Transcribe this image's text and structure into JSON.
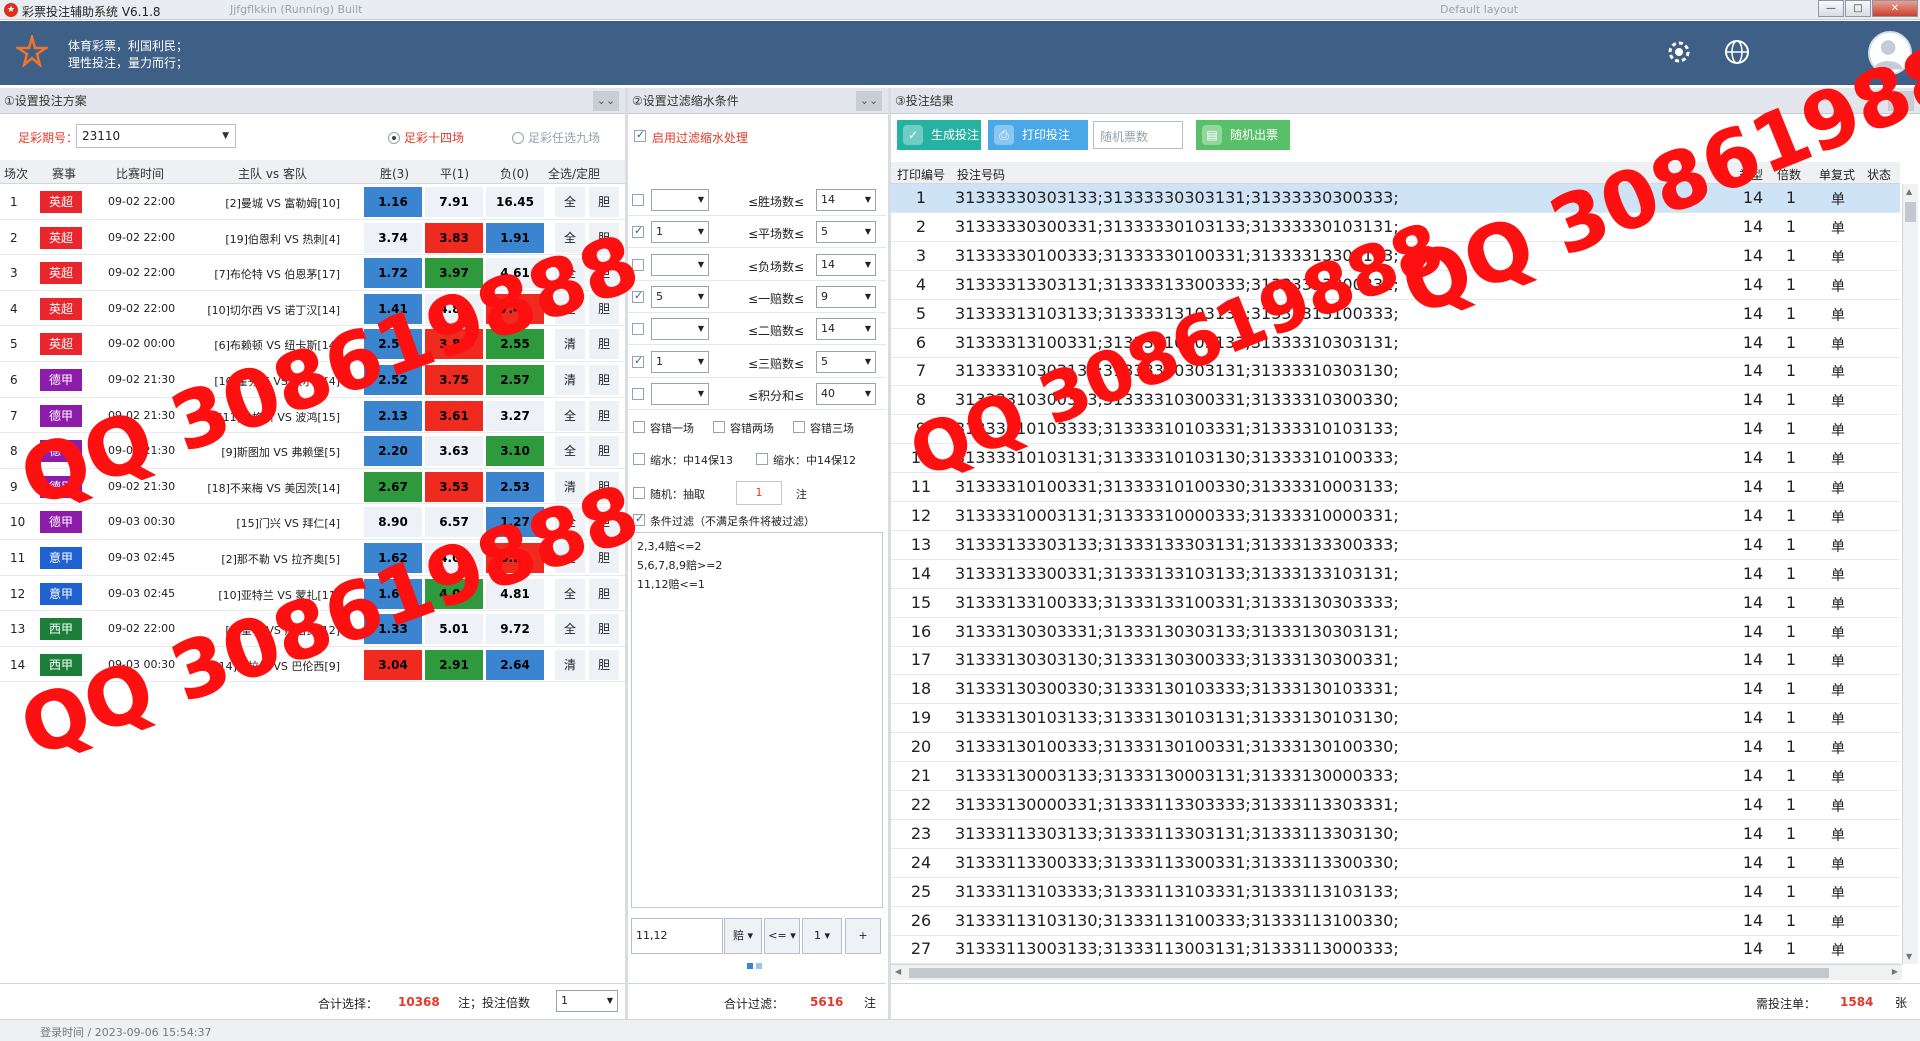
{
  "window": {
    "title": "彩票投注辅助系统 V6.1.8",
    "ghost_text": "Jjfgflkkin (Running) Built",
    "ghost_right": "Default layout"
  },
  "header": {
    "slogan1": "体育彩票，利国利民；",
    "slogan2": "理性投注，量力而行；"
  },
  "panel1": {
    "title": "①设置投注方案",
    "issue_label": "足彩期号：",
    "issue_value": "23110",
    "radio1": "足彩十四场",
    "radio2": "足彩任选九场",
    "columns": [
      "场次",
      "赛事",
      "比赛时间",
      "主队 vs 客队",
      "胜(3)",
      "平(1)",
      "负(0)",
      "全选/定胆"
    ],
    "rows": [
      {
        "idx": "1",
        "league": "英超",
        "lc": "#e8262b",
        "time": "09-02 22:00",
        "teams": "[2]曼城 VS 富勒姆[10]",
        "w": "1.16",
        "d": "7.91",
        "l": "16.45",
        "wc": "blue",
        "dc": "white",
        "lcx": "white",
        "b1": "全",
        "b2": "胆"
      },
      {
        "idx": "2",
        "league": "英超",
        "lc": "#e8262b",
        "time": "09-02 22:00",
        "teams": "[19]伯恩利 VS 热刺[4]",
        "w": "3.74",
        "d": "3.83",
        "l": "1.91",
        "wc": "white",
        "dc": "red",
        "lcx": "blue",
        "b1": "全",
        "b2": "胆"
      },
      {
        "idx": "3",
        "league": "英超",
        "lc": "#e8262b",
        "time": "09-02 22:00",
        "teams": "[7]布伦特 VS 伯恩茅[17]",
        "w": "1.72",
        "d": "3.97",
        "l": "4.61",
        "wc": "blue",
        "dc": "green",
        "lcx": "white",
        "b1": "全",
        "b2": "胆"
      },
      {
        "idx": "4",
        "league": "英超",
        "lc": "#e8262b",
        "time": "09-02 22:00",
        "teams": "[10]切尔西 VS 诺丁汉[14]",
        "w": "1.41",
        "d": "4.82",
        "l": "7.48",
        "wc": "blue",
        "dc": "white",
        "lcx": "red",
        "b1": "全",
        "b2": "胆"
      },
      {
        "idx": "5",
        "league": "英超",
        "lc": "#e8262b",
        "time": "09-02 00:00",
        "teams": "[6]布赖顿 VS 纽卡斯[14]",
        "w": "2.52",
        "d": "3.82",
        "l": "2.55",
        "wc": "blue",
        "dc": "red",
        "lcx": "green",
        "b1": "清",
        "b2": "胆"
      },
      {
        "idx": "6",
        "league": "德甲",
        "lc": "#8e1cab",
        "time": "09-02 21:30",
        "teams": "[10]霍芬海 VS 沃尔夫[4]",
        "w": "2.52",
        "d": "3.75",
        "l": "2.57",
        "wc": "blue",
        "dc": "red",
        "lcx": "green",
        "b1": "清",
        "b2": "胆"
      },
      {
        "idx": "7",
        "league": "德甲",
        "lc": "#8e1cab",
        "time": "09-02 21:30",
        "teams": "[11]奥格斯 VS 波鸿[15]",
        "w": "2.13",
        "d": "3.61",
        "l": "3.27",
        "wc": "blue",
        "dc": "red",
        "lcx": "white",
        "b1": "全",
        "b2": "胆"
      },
      {
        "idx": "8",
        "league": "德甲",
        "lc": "#8e1cab",
        "time": "09-02 21:30",
        "teams": "[9]斯图加 VS 弗赖堡[5]",
        "w": "2.20",
        "d": "3.63",
        "l": "3.10",
        "wc": "blue",
        "dc": "white",
        "lcx": "green",
        "b1": "全",
        "b2": "胆"
      },
      {
        "idx": "9",
        "league": "德甲",
        "lc": "#8e1cab",
        "time": "09-02 21:30",
        "teams": "[18]不来梅 VS 美因茨[14]",
        "w": "2.67",
        "d": "3.53",
        "l": "2.53",
        "wc": "green",
        "dc": "red",
        "lcx": "blue",
        "b1": "清",
        "b2": "胆"
      },
      {
        "idx": "10",
        "league": "德甲",
        "lc": "#8e1cab",
        "time": "09-03 00:30",
        "teams": "[15]门兴 VS 拜仁[4]",
        "w": "8.90",
        "d": "6.57",
        "l": "1.27",
        "wc": "white",
        "dc": "white",
        "lcx": "blue",
        "b1": "全",
        "b2": "胆"
      },
      {
        "idx": "11",
        "league": "意甲",
        "lc": "#1f62cf",
        "time": "09-03 02:45",
        "teams": "[2]那不勒 VS 拉齐奥[5]",
        "w": "1.62",
        "d": "4.08",
        "l": "5.22",
        "wc": "blue",
        "dc": "white",
        "lcx": "red",
        "b1": "全",
        "b2": "胆"
      },
      {
        "idx": "12",
        "league": "意甲",
        "lc": "#1f62cf",
        "time": "09-03 02:45",
        "teams": "[10]亚特兰 VS 蒙扎[11]",
        "w": "1.67",
        "d": "4.06",
        "l": "4.81",
        "wc": "blue",
        "dc": "green",
        "lcx": "white",
        "b1": "全",
        "b2": "胆"
      },
      {
        "idx": "13",
        "league": "西甲",
        "lc": "#1b7f3a",
        "time": "09-02 22:00",
        "teams": "[1]皇马 VS 赫塔费[12]",
        "w": "1.33",
        "d": "5.01",
        "l": "9.72",
        "wc": "blue",
        "dc": "white",
        "lcx": "white",
        "b1": "全",
        "b2": "胆"
      },
      {
        "idx": "14",
        "league": "西甲",
        "lc": "#1b7f3a",
        "time": "09-03 00:30",
        "teams": "[14]阿拉维 VS 巴伦西[9]",
        "w": "3.04",
        "d": "2.91",
        "l": "2.64",
        "wc": "red",
        "dc": "green",
        "lcx": "blue",
        "b1": "清",
        "b2": "胆"
      }
    ],
    "total_label": "合计选择：",
    "total_value": "10368",
    "bet_label": "注；投注倍数",
    "multiplier": "1"
  },
  "panel2": {
    "title": "②设置过滤缩水条件",
    "enable_label": "启用过滤缩水处理",
    "filters": [
      {
        "checked": false,
        "left": "",
        "label": "≤胜场数≤",
        "right": "14"
      },
      {
        "checked": true,
        "left": "1",
        "label": "≤平场数≤",
        "right": "5"
      },
      {
        "checked": false,
        "left": "",
        "label": "≤负场数≤",
        "right": "14"
      },
      {
        "checked": true,
        "left": "5",
        "label": "≤一赔数≤",
        "right": "9"
      },
      {
        "checked": false,
        "left": "",
        "label": "≤二赔数≤",
        "right": "14"
      },
      {
        "checked": true,
        "left": "1",
        "label": "≤三赔数≤",
        "right": "5"
      },
      {
        "checked": false,
        "left": "",
        "label": "≤积分和≤",
        "right": "40"
      }
    ],
    "tol1": "容错一场",
    "tol2": "容错两场",
    "tol3": "容错三场",
    "shrink1": "缩水：中14保13",
    "shrink2": "缩水：中14保12",
    "random_label": "随机：抽取",
    "random_value": "1",
    "random_unit": "注",
    "cond_label": "条件过滤（不满足条件将被过滤）",
    "cond_lines": [
      "2,3,4赔<=2",
      "5,6,7,8,9赔>=2",
      "11,12赔<=1"
    ],
    "input_value": "11,12",
    "tool1": "赔",
    "tool2": "<=",
    "tool3": "1",
    "tool4": "+",
    "total_label": "合计过滤：",
    "total_value": "5616",
    "total_unit": "注"
  },
  "panel3": {
    "title": "③投注结果",
    "btn_generate": "生成投注",
    "btn_print": "打印投注",
    "rand_placeholder": "随机票数",
    "btn_random": "随机出票",
    "columns": [
      "打印编号",
      "投注号码",
      "类型",
      "倍数",
      "单复式",
      "状态"
    ],
    "rows": [
      {
        "n": "1",
        "code": "31333330303133;31333330303131;31333330300333;"
      },
      {
        "n": "2",
        "code": "31333330300331;31333330103133;31333330103131;"
      },
      {
        "n": "3",
        "code": "31333330100333;31333330100331;31333313303133;"
      },
      {
        "n": "4",
        "code": "31333313303131;31333313300333;31333313300331;"
      },
      {
        "n": "5",
        "code": "31333313103133;31333313103131;31333313100333;"
      },
      {
        "n": "6",
        "code": "31333313100331;31333310303133;31333310303131;"
      },
      {
        "n": "7",
        "code": "31333310303133;31333310303131;31333310303130;"
      },
      {
        "n": "8",
        "code": "31333310300333;31333310300331;31333310300330;"
      },
      {
        "n": "9",
        "code": "31333310103333;31333310103331;31333310103133;"
      },
      {
        "n": "10",
        "code": "31333310103131;31333310103130;31333310100333;"
      },
      {
        "n": "11",
        "code": "31333310100331;31333310100330;31333310003133;"
      },
      {
        "n": "12",
        "code": "31333310003131;31333310000333;31333310000331;"
      },
      {
        "n": "13",
        "code": "31333133303133;31333133303131;31333133300333;"
      },
      {
        "n": "14",
        "code": "31333133300331;31333133103133;31333133103131;"
      },
      {
        "n": "15",
        "code": "31333133100333;31333133100331;31333130303333;"
      },
      {
        "n": "16",
        "code": "31333130303331;31333130303133;31333130303131;"
      },
      {
        "n": "17",
        "code": "31333130303130;31333130300333;31333130300331;"
      },
      {
        "n": "18",
        "code": "31333130300330;31333130103333;31333130103331;"
      },
      {
        "n": "19",
        "code": "31333130103133;31333130103131;31333130103130;"
      },
      {
        "n": "20",
        "code": "31333130100333;31333130100331;31333130100330;"
      },
      {
        "n": "21",
        "code": "31333130003133;31333130003131;31333130000333;"
      },
      {
        "n": "22",
        "code": "31333130000331;31333113303333;31333113303331;"
      },
      {
        "n": "23",
        "code": "31333113303133;31333113303131;31333113303130;"
      },
      {
        "n": "24",
        "code": "31333113300333;31333113300331;31333113300330;"
      },
      {
        "n": "25",
        "code": "31333113103333;31333113103331;31333113103133;"
      },
      {
        "n": "26",
        "code": "31333113103130;31333113100333;31333113100330;"
      },
      {
        "n": "27",
        "code": "31333113003133;31333113003131;31333113000333;"
      }
    ],
    "row_type": "14",
    "row_mult": "1",
    "row_form": "单",
    "need_label": "需投注单：",
    "need_value": "1584",
    "need_unit": "张"
  },
  "status": {
    "login": "登录时间 / 2023-09-06 15:54:37"
  },
  "watermark": "QQ 308619888",
  "colors": {
    "header": "#3e5f86",
    "accent_red": "#e23a2a",
    "odd_blue": "#3a84d0",
    "odd_red": "#ef2a1e",
    "odd_green": "#2f9a3d",
    "btn_generate": "#26b2a3",
    "btn_print": "#4aa8e8",
    "btn_random": "#59c06a"
  }
}
